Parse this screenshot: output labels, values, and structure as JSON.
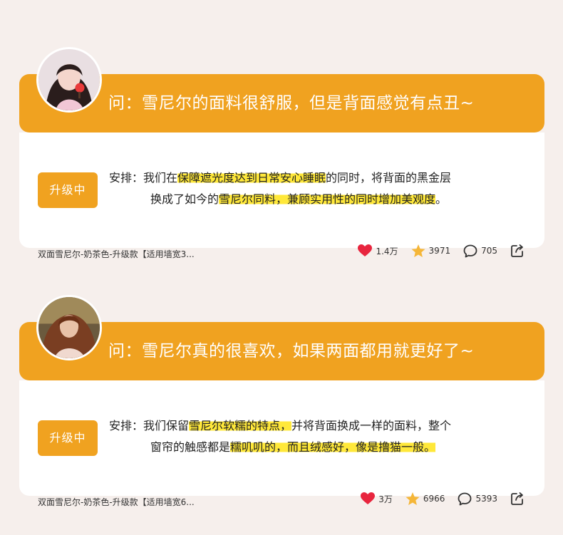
{
  "cards": [
    {
      "question": "问：雪尼尔的面料很舒服，但是背面感觉有点丑~",
      "badge": "升级中",
      "answer": {
        "lead": "安排：我们在",
        "hl1": "保障遮光度达到日常安心睡眠",
        "mid1": "的同时，将背面的黑金层",
        "mid2": "换成了如今的",
        "hl2": "雪尼尔同料，兼顾实用性的同时增加美观度",
        "tail": "。"
      },
      "product": "双面雪尼尔-奶茶色-升级款【适用墙宽3...",
      "likes": "1.4万",
      "favorites": "3971",
      "comments": "705"
    },
    {
      "question": "问：雪尼尔真的很喜欢，如果两面都用就更好了~",
      "badge": "升级中",
      "answer": {
        "lead": "安排：我们保留",
        "hl1": "雪尼尔软糯的特点，",
        "mid1": "并将背面换成一样的面料，整个",
        "mid2": "窗帘的触感都是",
        "hl2": "糯叽叽的，而且绒感好，像是撸猫一般。",
        "tail": ""
      },
      "product": "双面雪尼尔-奶茶色-升级款【适用墙宽6...",
      "likes": "3万",
      "favorites": "6966",
      "comments": "5393"
    }
  ],
  "colors": {
    "accent": "#f0a220",
    "highlight": "#ffe83a",
    "heart": "#e8253e",
    "star": "#f5b638",
    "background": "#f6efec"
  },
  "icons": [
    "avatar",
    "heart-icon",
    "star-icon",
    "comment-icon",
    "share-icon"
  ]
}
